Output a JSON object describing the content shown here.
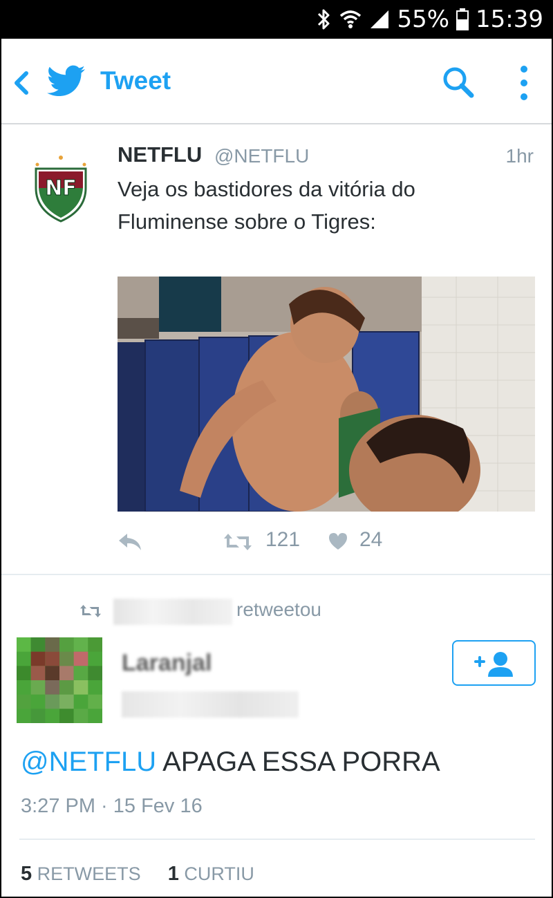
{
  "status_bar": {
    "battery": "55%",
    "clock": "15:39",
    "icons": [
      "bluetooth-icon",
      "wifi-icon",
      "signal-icon",
      "battery-icon"
    ]
  },
  "header": {
    "title": "Tweet",
    "icons": [
      "back-icon",
      "twitter-bird-icon",
      "search-icon",
      "more-vert-icon"
    ],
    "accent": "#1DA1F2"
  },
  "tweet": {
    "author_name": "NETFLU",
    "author_handle": "@NETFLU",
    "avatar_logo_text": "NF",
    "time": "1hr",
    "text_line1": "Veja os bastidores da vitória do",
    "text_line2": "Fluminense sobre o Tigres:",
    "retweet_count": "121",
    "like_count": "24"
  },
  "retweet_notice": {
    "label": "retweetou"
  },
  "reply": {
    "display_name": "Laranjal",
    "mention": "@NETFLU",
    "text": " APAGA ESSA PORRA",
    "timestamp": "3:27 PM · 15 Fev 16",
    "retweets_count": "5",
    "retweets_label": "RETWEETS",
    "likes_count": "1",
    "likes_label": "CURTIU"
  }
}
